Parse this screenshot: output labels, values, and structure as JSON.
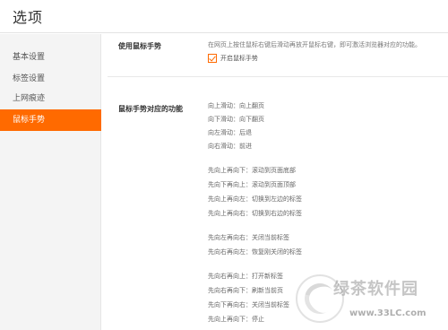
{
  "header": {
    "title": "选项"
  },
  "sidebar": {
    "items": [
      {
        "label": "基本设置"
      },
      {
        "label": "标签设置"
      },
      {
        "label": "上网痕迹"
      },
      {
        "label": "鼠标手势"
      }
    ],
    "active_index": 3
  },
  "mouse_gesture": {
    "section_label": "使用鼠标手势",
    "description": "在网页上按住鼠标右键后滑动再放开鼠标右键，即可激活浏览器对应的功能。",
    "checkbox_label": "开启鼠标手势",
    "checkbox_checked": true
  },
  "gesture_functions": {
    "section_label": "鼠标手势对应的功能",
    "items": [
      "向上滑动：向上翻页",
      "向下滑动：向下翻页",
      "向左滑动：后退",
      "向右滑动：前进",
      "先向上再向下：滚动到页面底部",
      "先向下再向上：滚动到页面顶部",
      "先向上再向左：切换到左边的标签",
      "先向上再向右：切换到右边的标签",
      "先向左再向右：关闭当前标签",
      "先向右再向左：恢复刚关闭的标签",
      "先向右再向上：打开新标签",
      "先向右再向下：刷新当前页",
      "先向下再向右：关闭当前标签",
      "先向上再向下：停止"
    ]
  },
  "watermark": {
    "text": "绿茶软件园",
    "url": "www.33LC.com"
  },
  "colors": {
    "accent": "#ff6a00",
    "sidebar_bg": "#f4f4f4"
  }
}
